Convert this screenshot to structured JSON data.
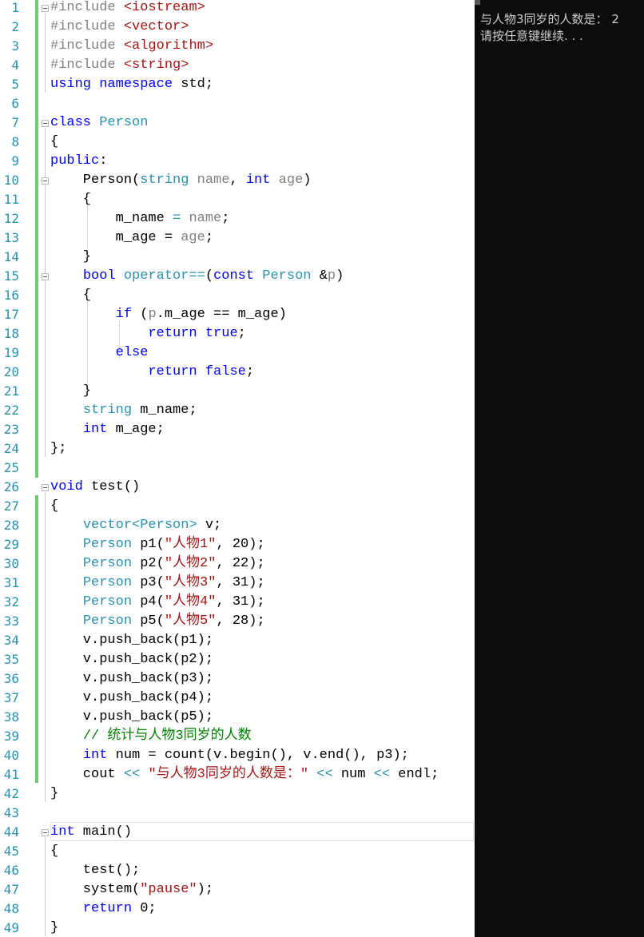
{
  "editor": {
    "line_numbers": [
      "1",
      "2",
      "3",
      "4",
      "5",
      "6",
      "7",
      "8",
      "9",
      "10",
      "11",
      "12",
      "13",
      "14",
      "15",
      "16",
      "17",
      "18",
      "19",
      "20",
      "21",
      "22",
      "23",
      "24",
      "25",
      "26",
      "27",
      "28",
      "29",
      "30",
      "31",
      "32",
      "33",
      "34",
      "35",
      "36",
      "37",
      "38",
      "39",
      "40",
      "41",
      "42",
      "43",
      "44",
      "45",
      "46",
      "47",
      "48",
      "49"
    ],
    "lines": [
      [
        [
          "pp",
          "#include "
        ],
        [
          "st",
          "<iostream>"
        ]
      ],
      [
        [
          "pp",
          "#include "
        ],
        [
          "st",
          "<vector>"
        ]
      ],
      [
        [
          "pp",
          "#include "
        ],
        [
          "st",
          "<algorithm>"
        ]
      ],
      [
        [
          "pp",
          "#include "
        ],
        [
          "st",
          "<string>"
        ]
      ],
      [
        [
          "kw",
          "using"
        ],
        [
          "tx",
          " "
        ],
        [
          "kw",
          "namespace"
        ],
        [
          "tx",
          " std;"
        ]
      ],
      [],
      [
        [
          "kw",
          "class"
        ],
        [
          "tx",
          " "
        ],
        [
          "ty",
          "Person"
        ]
      ],
      [
        [
          "tx",
          "{"
        ]
      ],
      [
        [
          "kw",
          "public"
        ],
        [
          "tx",
          ":"
        ]
      ],
      [
        [
          "tx",
          "    Person("
        ],
        [
          "ty",
          "string"
        ],
        [
          "tx",
          " "
        ],
        [
          "pm",
          "name"
        ],
        [
          "tx",
          ", "
        ],
        [
          "kw",
          "int"
        ],
        [
          "tx",
          " "
        ],
        [
          "pm",
          "age"
        ],
        [
          "tx",
          ")"
        ]
      ],
      [
        [
          "tx",
          "    {"
        ]
      ],
      [
        [
          "tx",
          "        m_name "
        ],
        [
          "ty",
          "="
        ],
        [
          "tx",
          " "
        ],
        [
          "pm",
          "name"
        ],
        [
          "tx",
          ";"
        ]
      ],
      [
        [
          "tx",
          "        m_age = "
        ],
        [
          "pm",
          "age"
        ],
        [
          "tx",
          ";"
        ]
      ],
      [
        [
          "tx",
          "    }"
        ]
      ],
      [
        [
          "tx",
          "    "
        ],
        [
          "kw",
          "bool"
        ],
        [
          "tx",
          " "
        ],
        [
          "ty",
          "operator=="
        ],
        [
          "tx",
          "("
        ],
        [
          "kw",
          "const"
        ],
        [
          "tx",
          " "
        ],
        [
          "ty",
          "Person"
        ],
        [
          "tx",
          " &"
        ],
        [
          "pm",
          "p"
        ],
        [
          "tx",
          ")"
        ]
      ],
      [
        [
          "tx",
          "    {"
        ]
      ],
      [
        [
          "tx",
          "        "
        ],
        [
          "kw",
          "if"
        ],
        [
          "tx",
          " ("
        ],
        [
          "pm",
          "p"
        ],
        [
          "tx",
          ".m_age == m_age)"
        ]
      ],
      [
        [
          "tx",
          "            "
        ],
        [
          "kw",
          "return"
        ],
        [
          "tx",
          " "
        ],
        [
          "kw",
          "true"
        ],
        [
          "tx",
          ";"
        ]
      ],
      [
        [
          "tx",
          "        "
        ],
        [
          "kw",
          "else"
        ]
      ],
      [
        [
          "tx",
          "            "
        ],
        [
          "kw",
          "return"
        ],
        [
          "tx",
          " "
        ],
        [
          "kw",
          "false"
        ],
        [
          "tx",
          ";"
        ]
      ],
      [
        [
          "tx",
          "    }"
        ]
      ],
      [
        [
          "tx",
          "    "
        ],
        [
          "ty",
          "string"
        ],
        [
          "tx",
          " m_name;"
        ]
      ],
      [
        [
          "tx",
          "    "
        ],
        [
          "kw",
          "int"
        ],
        [
          "tx",
          " m_age;"
        ]
      ],
      [
        [
          "tx",
          "};"
        ]
      ],
      [],
      [
        [
          "kw",
          "void"
        ],
        [
          "tx",
          " test()"
        ]
      ],
      [
        [
          "tx",
          "{"
        ]
      ],
      [
        [
          "tx",
          "    "
        ],
        [
          "ty",
          "vector"
        ],
        [
          "ty",
          "<Person>"
        ],
        [
          "tx",
          " v;"
        ]
      ],
      [
        [
          "tx",
          "    "
        ],
        [
          "ty",
          "Person"
        ],
        [
          "tx",
          " p1("
        ],
        [
          "st",
          "\"人物1\""
        ],
        [
          "tx",
          ", 20);"
        ]
      ],
      [
        [
          "tx",
          "    "
        ],
        [
          "ty",
          "Person"
        ],
        [
          "tx",
          " p2("
        ],
        [
          "st",
          "\"人物2\""
        ],
        [
          "tx",
          ", 22);"
        ]
      ],
      [
        [
          "tx",
          "    "
        ],
        [
          "ty",
          "Person"
        ],
        [
          "tx",
          " p3("
        ],
        [
          "st",
          "\"人物3\""
        ],
        [
          "tx",
          ", 31);"
        ]
      ],
      [
        [
          "tx",
          "    "
        ],
        [
          "ty",
          "Person"
        ],
        [
          "tx",
          " p4("
        ],
        [
          "st",
          "\"人物4\""
        ],
        [
          "tx",
          ", 31);"
        ]
      ],
      [
        [
          "tx",
          "    "
        ],
        [
          "ty",
          "Person"
        ],
        [
          "tx",
          " p5("
        ],
        [
          "st",
          "\"人物5\""
        ],
        [
          "tx",
          ", 28);"
        ]
      ],
      [
        [
          "tx",
          "    v.push_back(p1);"
        ]
      ],
      [
        [
          "tx",
          "    v.push_back(p2);"
        ]
      ],
      [
        [
          "tx",
          "    v.push_back(p3);"
        ]
      ],
      [
        [
          "tx",
          "    v.push_back(p4);"
        ]
      ],
      [
        [
          "tx",
          "    v.push_back(p5);"
        ]
      ],
      [
        [
          "tx",
          "    "
        ],
        [
          "cm",
          "// 统计与人物3同岁的人数"
        ]
      ],
      [
        [
          "tx",
          "    "
        ],
        [
          "kw",
          "int"
        ],
        [
          "tx",
          " num = count(v.begin(), v.end(), p3);"
        ]
      ],
      [
        [
          "tx",
          "    cout "
        ],
        [
          "ty",
          "<<"
        ],
        [
          "tx",
          " "
        ],
        [
          "st",
          "\"与人物3同岁的人数是：\""
        ],
        [
          "tx",
          " "
        ],
        [
          "ty",
          "<<"
        ],
        [
          "tx",
          " num "
        ],
        [
          "ty",
          "<<"
        ],
        [
          "tx",
          " endl;"
        ]
      ],
      [
        [
          "tx",
          "}"
        ]
      ],
      [],
      [
        [
          "kw",
          "int"
        ],
        [
          "tx",
          " main()"
        ]
      ],
      [
        [
          "tx",
          "{"
        ]
      ],
      [
        [
          "tx",
          "    test();"
        ]
      ],
      [
        [
          "tx",
          "    system("
        ],
        [
          "st",
          "\"pause\""
        ],
        [
          "tx",
          ");"
        ]
      ],
      [
        [
          "tx",
          "    "
        ],
        [
          "kw",
          "return"
        ],
        [
          "tx",
          " 0;"
        ]
      ],
      [
        [
          "tx",
          "}"
        ]
      ]
    ]
  },
  "console": {
    "lines": [
      "与人物3同岁的人数是： 2",
      "请按任意键继续. . ."
    ]
  }
}
